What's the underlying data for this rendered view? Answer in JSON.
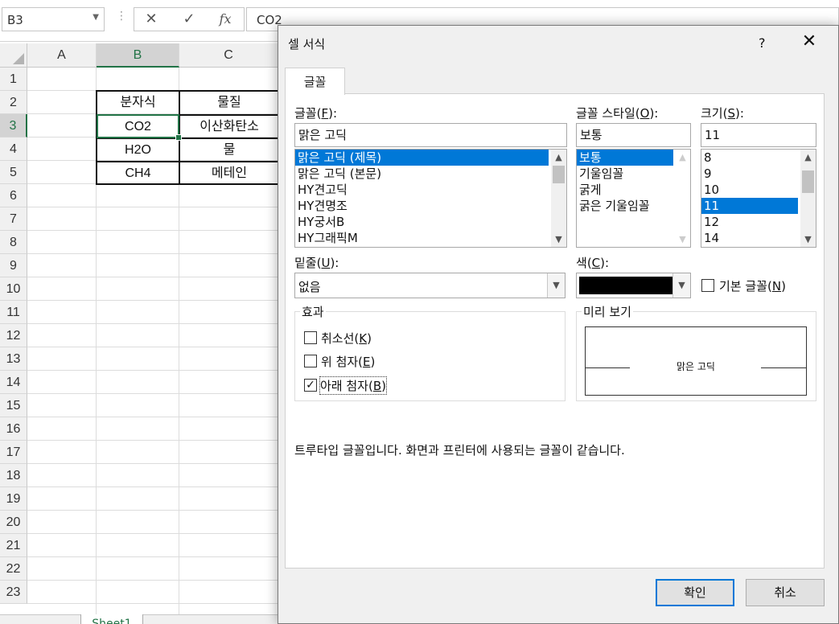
{
  "formula_bar": {
    "name_box": "B3",
    "formula": "CO2"
  },
  "sheet": {
    "columns": [
      "A",
      "B",
      "C"
    ],
    "rows": [
      "1",
      "2",
      "3",
      "4",
      "5",
      "6",
      "7",
      "8",
      "9",
      "10",
      "11",
      "12",
      "13",
      "14",
      "15",
      "16",
      "17",
      "18",
      "19",
      "20",
      "21",
      "22",
      "23"
    ],
    "table": [
      [
        "분자식",
        "물질"
      ],
      [
        "CO2",
        "이산화탄소"
      ],
      [
        "H2O",
        "물"
      ],
      [
        "CH4",
        "메테인"
      ]
    ],
    "tab_name": "Sheet1"
  },
  "dialog": {
    "title": "셀 서식",
    "help": "?",
    "tab": "글꼴",
    "font_label": "글꼴",
    "font_key": "F",
    "font_value": "맑은 고딕",
    "font_list": [
      "맑은 고딕 (제목)",
      "맑은 고딕 (본문)",
      "HY견고딕",
      "HY견명조",
      "HY궁서B",
      "HY그래픽M"
    ],
    "style_label": "글꼴 스타일",
    "style_key": "O",
    "style_value": "보통",
    "style_list": [
      "보통",
      "기울임꼴",
      "굵게",
      "굵은 기울임꼴"
    ],
    "size_label": "크기",
    "size_key": "S",
    "size_value": "11",
    "size_list": [
      "8",
      "9",
      "10",
      "11",
      "12",
      "14"
    ],
    "underline_label": "밑줄",
    "underline_key": "U",
    "underline_value": "없음",
    "color_label": "색",
    "color_key": "C",
    "color_value": "#000000",
    "normal_font_label": "기본 글꼴",
    "normal_font_key": "N",
    "effects_label": "효과",
    "strike_label": "취소선",
    "strike_key": "K",
    "super_label": "위 첨자",
    "super_key": "E",
    "sub_label": "아래 첨자",
    "sub_key": "B",
    "preview_label": "미리 보기",
    "preview_text": "맑은 고딕",
    "info": "트루타입 글꼴입니다. 화면과 프린터에 사용되는 글꼴이 같습니다.",
    "ok": "확인",
    "cancel": "취소"
  },
  "colors": {
    "excel_green": "#217346",
    "selection_blue": "#0078d7"
  }
}
